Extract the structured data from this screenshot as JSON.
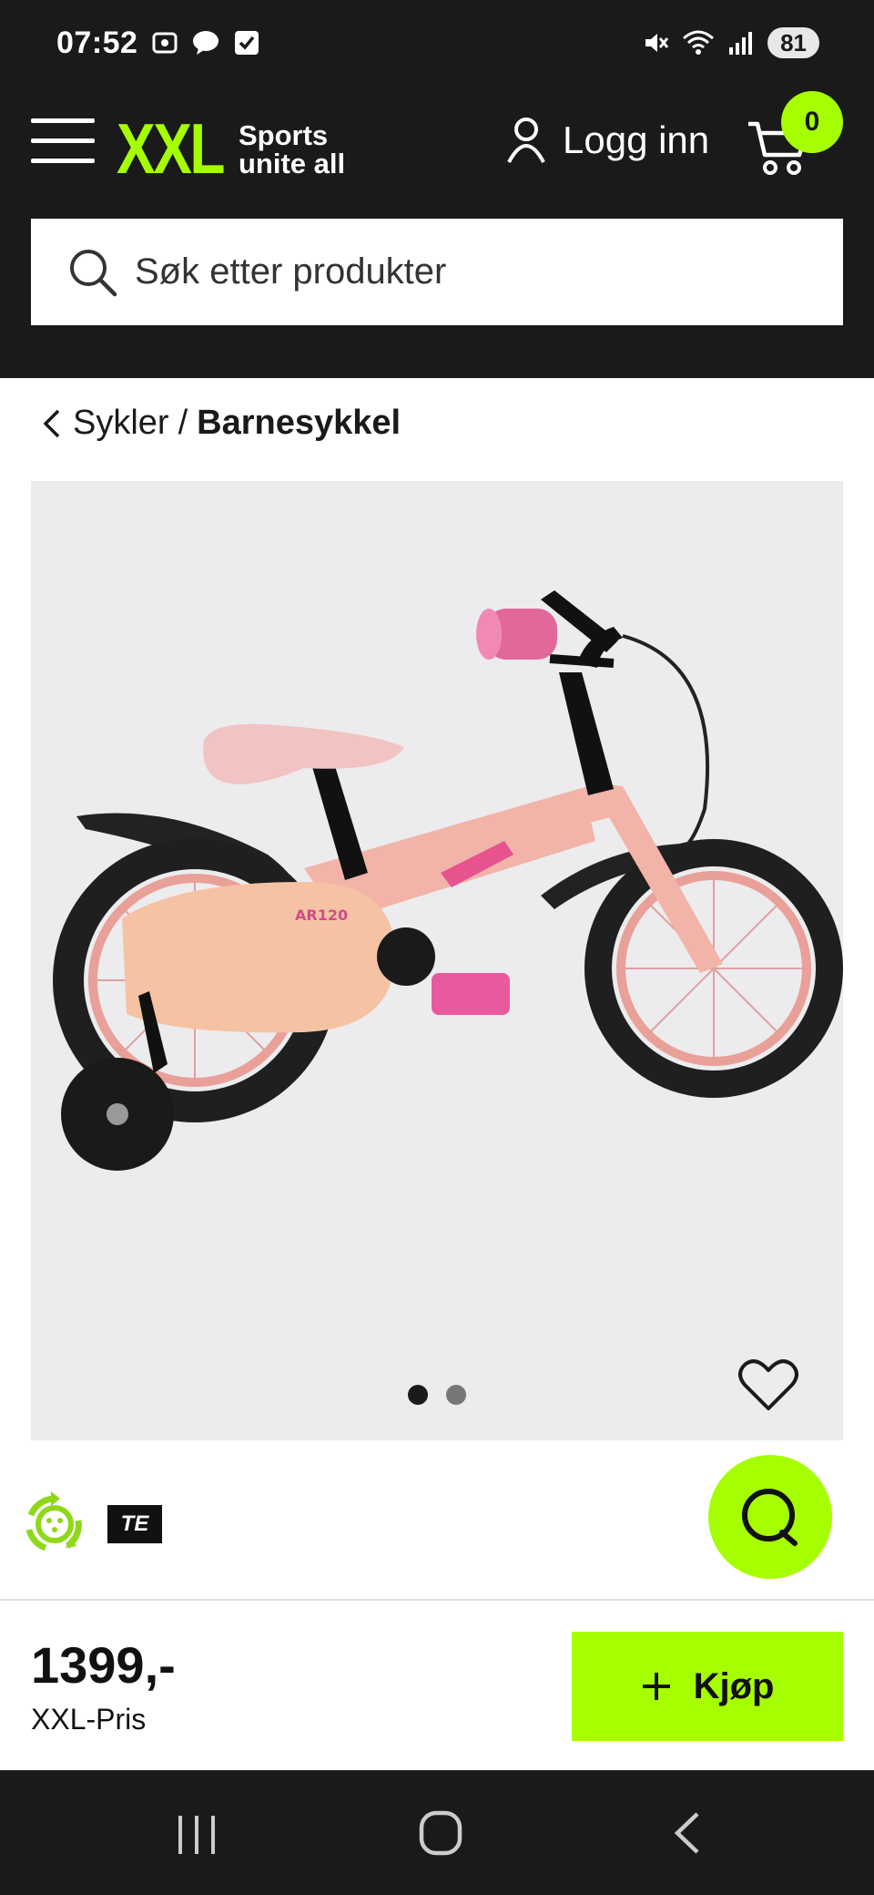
{
  "status_bar": {
    "time": "07:52",
    "battery": "81",
    "icons_left": [
      "screenshot-icon",
      "chat-bubble-icon",
      "checkbox-icon"
    ],
    "icons_right": [
      "mute-icon",
      "wifi-icon",
      "signal-icon"
    ]
  },
  "header": {
    "logo_text": "XXL",
    "logo_tagline_1": "Sports",
    "logo_tagline_2": "unite all",
    "login_label": "Logg inn",
    "cart_count": "0",
    "search_placeholder": "Søk etter produkter"
  },
  "breadcrumb": {
    "parent": "Sykler",
    "separator": "/",
    "current": "Barnesykkel"
  },
  "gallery": {
    "image_count": 2,
    "active_index": 0,
    "frame_logo_text": "AR120"
  },
  "badges": {
    "brand": "TE"
  },
  "buy_bar": {
    "price": "1399,-",
    "price_label": "XXL-Pris",
    "buy_label": "Kjøp"
  },
  "colors": {
    "accent": "#a6ff00",
    "dark": "#1a1a1a",
    "gallery_bg": "#ececee"
  }
}
